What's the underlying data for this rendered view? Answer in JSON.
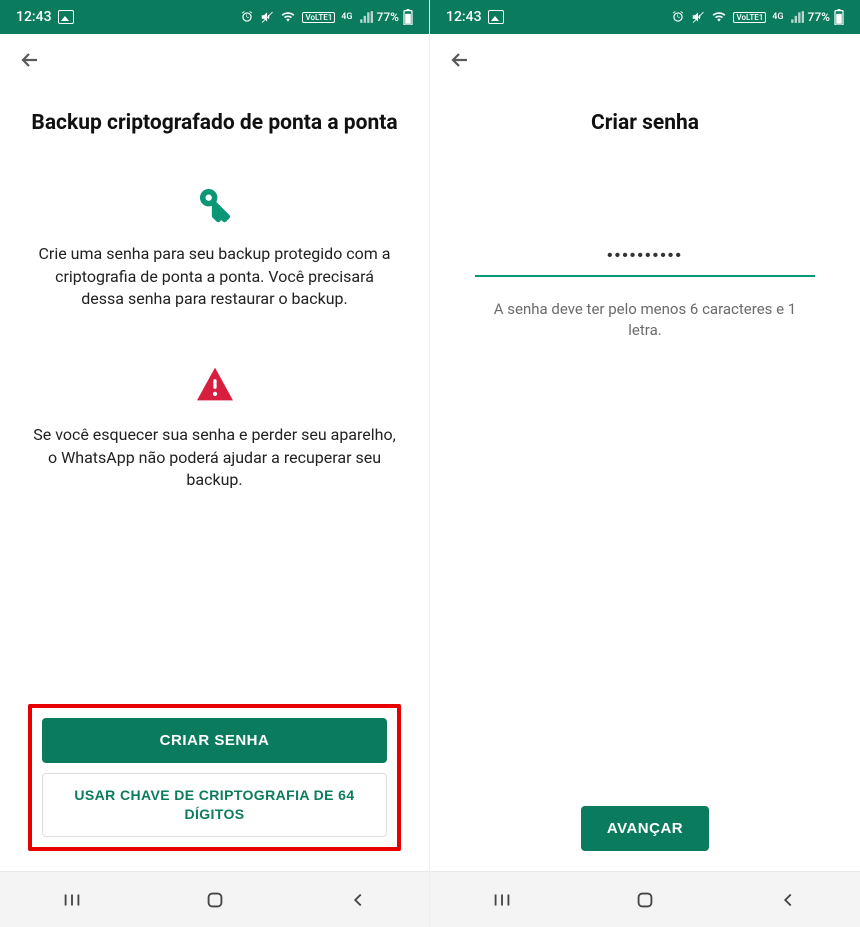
{
  "statusBar": {
    "time": "12:43",
    "network": "4G",
    "lte": "VoLTE1",
    "battery": "77%"
  },
  "left": {
    "title": "Backup criptografado de ponta a ponta",
    "info_text": "Crie uma senha para seu backup protegido com a criptografia de ponta a ponta. Você precisará dessa senha para restaurar o backup.",
    "warn_text": "Se você esquecer sua senha e perder seu aparelho, o WhatsApp não poderá ajudar a recuperar seu backup.",
    "btn_primary": "CRIAR SENHA",
    "btn_secondary": "USAR CHAVE DE CRIPTOGRAFIA DE 64 DÍGITOS"
  },
  "right": {
    "title": "Criar senha",
    "password_value": "••••••••••",
    "password_hint": "A senha deve ter pelo menos 6 caracteres e 1 letra.",
    "btn_advance": "AVANÇAR"
  }
}
